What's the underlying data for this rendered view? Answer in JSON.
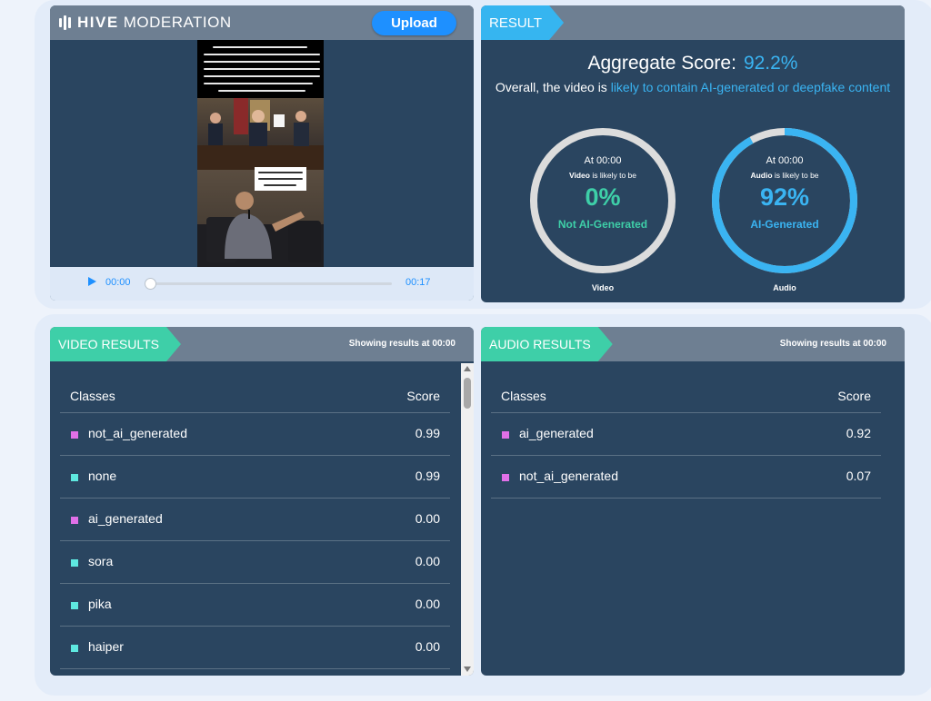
{
  "brand": {
    "bold": "HIVE",
    "light": "MODERATION"
  },
  "upload_label": "Upload",
  "player": {
    "current_time": "00:00",
    "duration": "00:17",
    "progress": 0
  },
  "result": {
    "tag": "RESULT",
    "aggregate_label": "Aggregate Score:",
    "aggregate_value": "92.2%",
    "overall_prefix": "Overall, the video is ",
    "overall_link": "likely to contain AI-generated or deepfake content",
    "gauges": [
      {
        "at": "At 00:00",
        "kind": "Video",
        "likely": " is likely to be",
        "pct": "0%",
        "label": "Not AI-Generated",
        "caption": "Video",
        "fraction": 0.0,
        "color": "#3ecfa8"
      },
      {
        "at": "At 00:00",
        "kind": "Audio",
        "likely": " is likely to be",
        "pct": "92%",
        "label": "AI-Generated",
        "caption": "Audio",
        "fraction": 0.92,
        "color": "#3ab4f2"
      }
    ]
  },
  "video_results": {
    "tag": "VIDEO RESULTS",
    "showing_prefix": "Showing results at ",
    "showing_time": "00:00",
    "col_classes": "Classes",
    "col_score": "Score",
    "rows": [
      {
        "cls": "not_ai_generated",
        "score": "0.99",
        "color": "#e070e8"
      },
      {
        "cls": "none",
        "score": "0.99",
        "color": "#5ee8e0"
      },
      {
        "cls": "ai_generated",
        "score": "0.00",
        "color": "#e070e8"
      },
      {
        "cls": "sora",
        "score": "0.00",
        "color": "#5ee8e0"
      },
      {
        "cls": "pika",
        "score": "0.00",
        "color": "#5ee8e0"
      },
      {
        "cls": "haiper",
        "score": "0.00",
        "color": "#5ee8e0"
      }
    ]
  },
  "audio_results": {
    "tag": "AUDIO RESULTS",
    "showing_prefix": "Showing results at ",
    "showing_time": "00:00",
    "col_classes": "Classes",
    "col_score": "Score",
    "rows": [
      {
        "cls": "ai_generated",
        "score": "0.92",
        "color": "#e070e8"
      },
      {
        "cls": "not_ai_generated",
        "score": "0.07",
        "color": "#e070e8"
      }
    ]
  }
}
